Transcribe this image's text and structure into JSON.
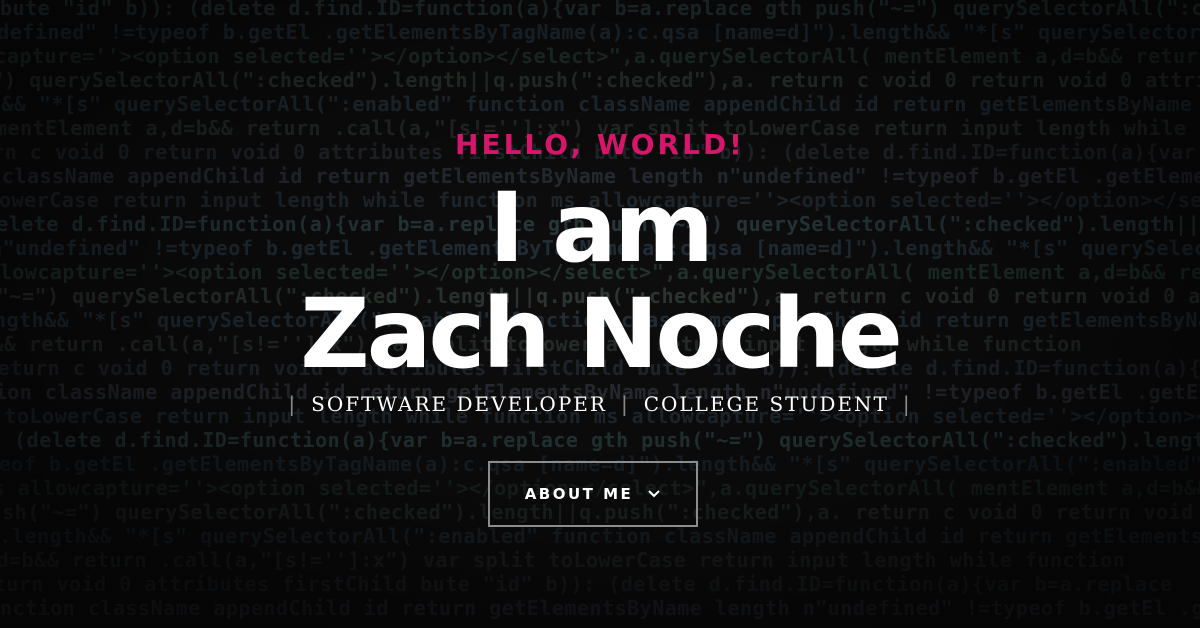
{
  "background": {
    "code_lines": [
      {
        "t": "bute \"id\"    b)): (delete   d.find.ID=function(a){var b=a.replace",
        "c": "#47686a"
      },
      {
        "t": "n\"undefined\" !=typeof  b.getEl  .getElementsByTagName(a):c.qsa",
        "c": "#3c5466"
      },
      {
        "t": "ms allowcapture=''><option selected=''></option></select>\",a.querySelectorAll(",
        "c": "#3a5c52"
      },
      {
        "t": "gth  push(\"~=\")  querySelectorAll(\":checked\").length||q.push(\":checked\"),a.",
        "c": "#4f5f55"
      },
      {
        "t": "[name=d]\").length&&  \"*[s\"  querySelectorAll(\":enabled\"",
        "c": "#3c5466"
      },
      {
        "t": "mentElement  a,d=b&&  return  .call(a,\"[s!='']:x\")",
        "c": "#44504a"
      },
      {
        "t": " return  c  void 0  return  void 0  attributes  firstChild",
        "c": "#3d4650"
      },
      {
        "t": "function  className  appendChild  id  return  getElementsByName  length",
        "c": "#4a5060"
      },
      {
        "t": "var  split  toLowerCase  return  input  length  while  function",
        "c": "#3a4a58"
      }
    ]
  },
  "hero": {
    "greeting": "HELLO, WORLD!",
    "name_line1": "I am",
    "name_line2": "Zach Noche",
    "roles": [
      "SOFTWARE DEVELOPER",
      "COLLEGE STUDENT"
    ],
    "separator": "|"
  },
  "about_button": {
    "label": "ABOUT ME",
    "icon": "chevron-down-icon"
  },
  "colors": {
    "accent": "#d6166a",
    "text": "#ffffff",
    "button_border": "#8d8d8d",
    "background": "#151515"
  }
}
